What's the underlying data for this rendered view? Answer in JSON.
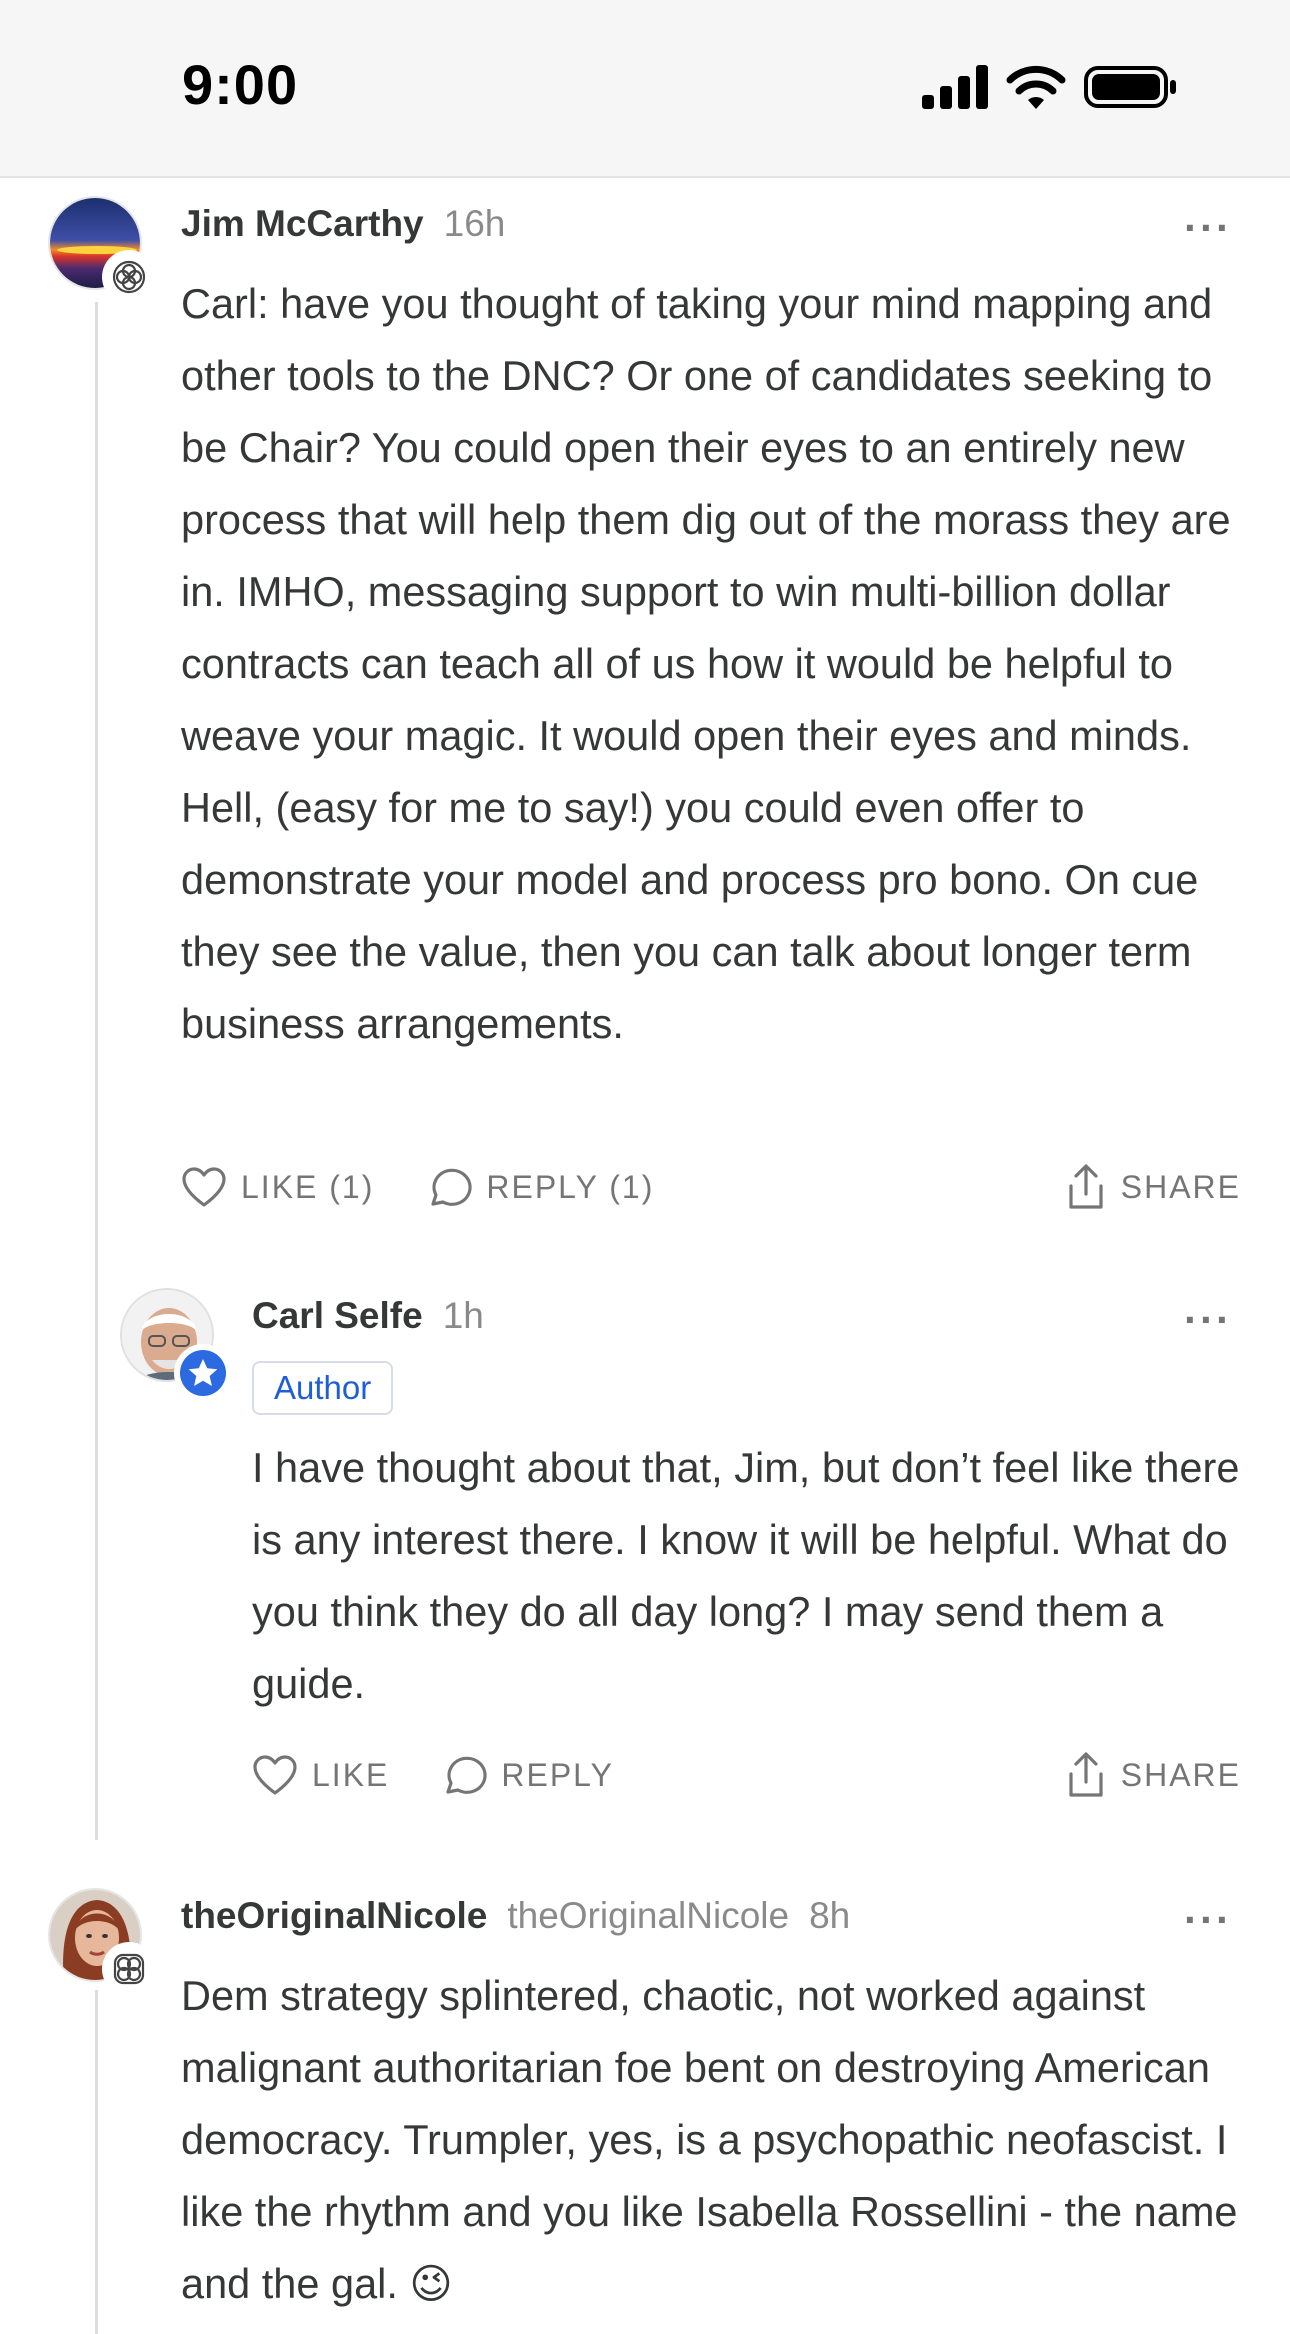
{
  "status_bar": {
    "time": "9:00"
  },
  "comments": [
    {
      "name": "Jim McCarthy",
      "time": "16h",
      "paragraph": "Carl: have you thought of taking your mind mapping and other tools to the DNC? Or one of candidates seeking to be Chair? You could open their eyes to an entirely new process that will help them dig out of the morass they are in. IMHO, messaging support to win multi-billion dollar contracts can teach all of us how it would be helpful to weave your magic. It would open their eyes and minds. Hell, (easy for me to say!) you could even offer to demonstrate your model and process pro bono. On cue they see the value, then you can talk about longer term business arrangements.",
      "actions": {
        "like": "LIKE (1)",
        "reply": "REPLY (1)",
        "share": "SHARE"
      }
    },
    {
      "name": "Carl Selfe",
      "time": "1h",
      "tag": "Author",
      "paragraph": "I have thought about that, Jim, but don’t feel like there is any interest there. I know it will be helpful. What do you think they do all day long? I may send them a guide.",
      "actions": {
        "like": "LIKE",
        "reply": "REPLY",
        "share": "SHARE"
      }
    },
    {
      "name": "theOriginalNicole",
      "handle": "theOriginalNicole",
      "time": "8h",
      "paragraph": "Dem strategy splintered, chaotic, not worked against malignant authoritarian foe bent on destroying American democracy. Trumpler, yes, is a psychopathic neofascist. I like the rhythm and you like Isabella Rossellini - the name and the gal. 😉"
    }
  ],
  "more_label": "···"
}
